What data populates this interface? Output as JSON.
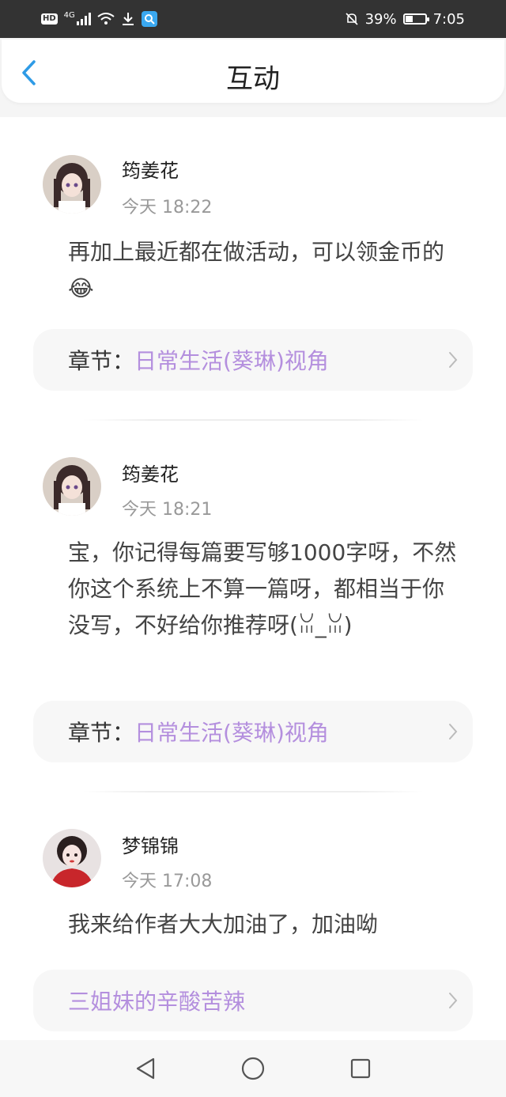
{
  "status_bar": {
    "hd": "HD",
    "network": "4G",
    "battery": "39%",
    "time": "7:05"
  },
  "header": {
    "title": "互动"
  },
  "comments": [
    {
      "username": "筠姜花",
      "time": "今天 18:22",
      "text": "再加上最近都在做活动，可以领金币的😂",
      "chapter_label": "章节：",
      "chapter_link": "日常生活(葵琳)视角"
    },
    {
      "username": "筠姜花",
      "time": "今天 18:21",
      "text": "宝，你记得每篇要写够1000字呀，不然你这个系统上不算一篇呀，都相当于你没写，不好给你推荐呀(ꈍ_ꈍ)",
      "chapter_label": "章节：",
      "chapter_link": "日常生活(葵琳)视角"
    },
    {
      "username": "梦锦锦",
      "time": "今天 17:08",
      "text": "我来给作者大大加油了，加油呦",
      "chapter_label": "",
      "chapter_link": "三姐妹的辛酸苦辣"
    }
  ],
  "colors": {
    "accent_link": "#b48fde",
    "back_arrow": "#2e9be6"
  },
  "icons": {
    "back": "back-arrow-icon",
    "chevron": "chevron-right-icon",
    "nav_back": "triangle-back-icon",
    "nav_home": "circle-home-icon",
    "nav_recent": "square-recents-icon"
  }
}
